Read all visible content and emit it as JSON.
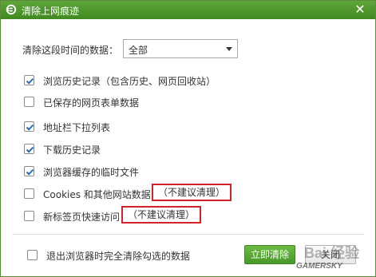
{
  "window": {
    "title": "清除上网痕迹",
    "close_glyph": "✕"
  },
  "range": {
    "label": "清除这段时间的数据：",
    "selected": "全部"
  },
  "options": [
    {
      "label": "浏览历史记录（包含历史、网页回收站）",
      "checked": true
    },
    {
      "label": "已保存的网页表单数据",
      "checked": false
    },
    {
      "label": "地址栏下拉列表",
      "checked": true
    },
    {
      "label": "下载历史记录",
      "checked": true
    },
    {
      "label": "浏览器缓存的临时文件",
      "checked": true
    },
    {
      "label": "Cookies 和其他网站数据",
      "checked": false,
      "note": "（不建议清理）"
    },
    {
      "label": "新标签页快速访问",
      "checked": false,
      "note": "（不建议清理）"
    }
  ],
  "footer": {
    "exit_clear_label": "退出浏览器时完全清除勾选的数据",
    "exit_clear_checked": false,
    "clear_now": "立即清除",
    "close": "关闭"
  },
  "watermark": {
    "main": "Bai 经验",
    "sub": "GAMERSKY"
  },
  "colors": {
    "titlebar": "#4a9a2a",
    "check": "#2b6cb0",
    "highlight_border": "#d2232a",
    "primary_button": "#5aab36"
  }
}
